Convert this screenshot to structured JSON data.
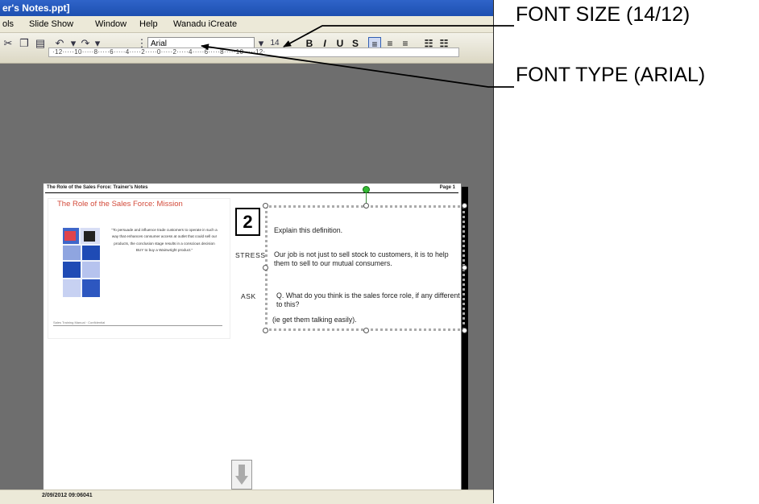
{
  "window": {
    "title": "er's Notes.ppt]"
  },
  "menu": {
    "items": [
      "ols",
      "Slide Show",
      "Window",
      "Help",
      "Wanadu iCreate"
    ]
  },
  "toolbar": {
    "font_name": "Arial",
    "font_size": "14",
    "format_buttons": [
      "B",
      "I",
      "U",
      "S"
    ]
  },
  "ruler": {
    "text": "·12·····10·····8·····6·····4·····2·····0·····2·····4·····6·····8·····10·····12·"
  },
  "page": {
    "header_left": "The Role of the Sales Force: Trainer's Notes",
    "header_right": "Page 1",
    "slide": {
      "title": "The Role of the Sales Force:  Mission",
      "quote": "\"To persuade and influence trade customers to operate in such a way that enhances consumer access at outlet that could sell our products, the conclusion stage results in a conscious decision BUY to buy a Wainwright product.\"",
      "footer": "Sales Training Manual · Confidential"
    },
    "slide_number": "2",
    "stress_label": "STRESS",
    "ask_label": "ASK",
    "notes": [
      "Explain this definition.",
      "Our job is not just to sell stock to customers, it is to help them to sell to our mutual consumers.",
      "Q.   What do you think is the sales force role, if any different to this?",
      "(ie get them talking easily)."
    ],
    "status": "2/09/2012 09:06041"
  },
  "callouts": {
    "font_size": "FONT SIZE (14/12)",
    "font_type": "FONT TYPE (ARIAL)"
  },
  "colors": {
    "title_bar": "#2f64c9",
    "slide_title": "#d34a3a",
    "rotate_handle": "#33bb33"
  }
}
